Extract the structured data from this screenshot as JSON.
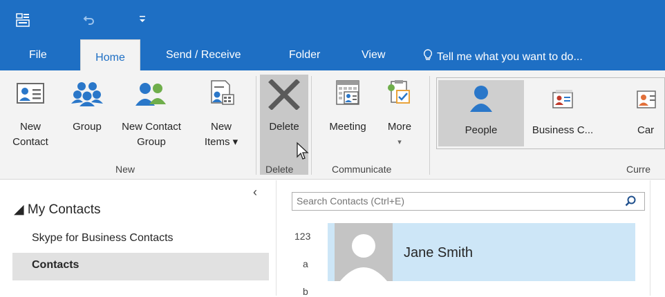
{
  "colors": {
    "accent": "#1e6fc4",
    "ribbon_bg": "#f3f3f3",
    "selected_card": "#cde6f7",
    "delete_highlight": "#c8c8c8"
  },
  "quick_access": {
    "app_icon": "outlook-icon",
    "undo_icon": "undo-icon",
    "customize_icon": "customize-quick-access-icon"
  },
  "tabs": {
    "file": "File",
    "home": "Home",
    "send_receive": "Send / Receive",
    "folder": "Folder",
    "view": "View",
    "tell_me": "Tell me what you want to do..."
  },
  "ribbon": {
    "new_contact": [
      "New",
      "Contact"
    ],
    "group": "Group",
    "new_contact_group": [
      "New Contact",
      "Group"
    ],
    "new_items": [
      "New",
      "Items ▾"
    ],
    "new_group_label": "New",
    "delete": "Delete",
    "delete_group_label": "Delete",
    "meeting": "Meeting",
    "more": "More",
    "more_arrow": "▾",
    "communicate_group_label": "Communicate",
    "views": {
      "people": "People",
      "business_card": "Business C...",
      "card": "Car"
    },
    "current_view_label": "Curre"
  },
  "nav": {
    "collapse_glyph": "‹",
    "my_contacts": "◢ My Contacts",
    "skype": "Skype for Business Contacts",
    "contacts": "Contacts"
  },
  "search": {
    "placeholder": "Search Contacts (Ctrl+E)",
    "icon": "search-icon"
  },
  "index": [
    "123",
    "a",
    "b"
  ],
  "contact_card": {
    "name": "Jane Smith"
  }
}
